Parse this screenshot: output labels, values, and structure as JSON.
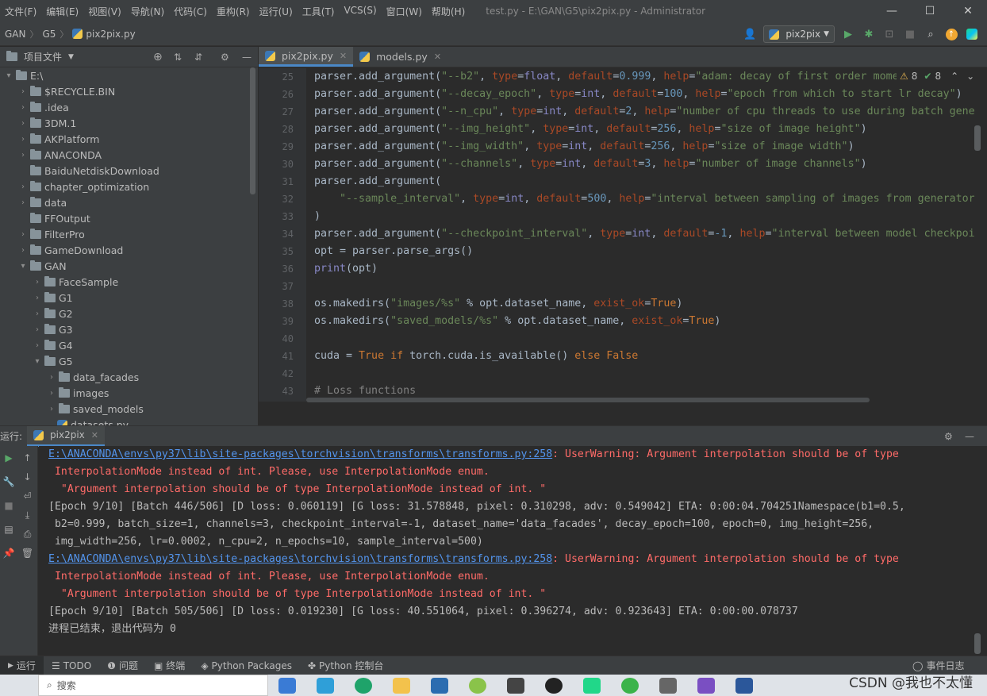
{
  "menu": {
    "items": [
      "文件(F)",
      "编辑(E)",
      "视图(V)",
      "导航(N)",
      "代码(C)",
      "重构(R)",
      "运行(U)",
      "工具(T)",
      "VCS(S)",
      "窗口(W)",
      "帮助(H)"
    ],
    "window_title": "test.py - E:\\GAN\\G5\\pix2pix.py - Administrator"
  },
  "breadcrumbs": [
    "GAN",
    "G5",
    "pix2pix.py"
  ],
  "run_config": "pix2pix",
  "project": {
    "header": "项目文件",
    "tree": [
      {
        "label": "E:\\",
        "indent": 0,
        "arrow": "open",
        "folder": true
      },
      {
        "label": "$RECYCLE.BIN",
        "indent": 1,
        "arrow": "closed",
        "folder": true
      },
      {
        "label": ".idea",
        "indent": 1,
        "arrow": "closed",
        "folder": true
      },
      {
        "label": "3DM.1",
        "indent": 1,
        "arrow": "closed",
        "folder": true
      },
      {
        "label": "AKPlatform",
        "indent": 1,
        "arrow": "closed",
        "folder": true
      },
      {
        "label": "ANACONDA",
        "indent": 1,
        "arrow": "closed",
        "folder": true
      },
      {
        "label": "BaiduNetdiskDownload",
        "indent": 1,
        "arrow": "none",
        "folder": true
      },
      {
        "label": "chapter_optimization",
        "indent": 1,
        "arrow": "closed",
        "folder": true
      },
      {
        "label": "data",
        "indent": 1,
        "arrow": "closed",
        "folder": true
      },
      {
        "label": "FFOutput",
        "indent": 1,
        "arrow": "none",
        "folder": true
      },
      {
        "label": "FilterPro",
        "indent": 1,
        "arrow": "closed",
        "folder": true
      },
      {
        "label": "GameDownload",
        "indent": 1,
        "arrow": "closed",
        "folder": true
      },
      {
        "label": "GAN",
        "indent": 1,
        "arrow": "open",
        "folder": true
      },
      {
        "label": "FaceSample",
        "indent": 2,
        "arrow": "closed",
        "folder": true
      },
      {
        "label": "G1",
        "indent": 2,
        "arrow": "closed",
        "folder": true
      },
      {
        "label": "G2",
        "indent": 2,
        "arrow": "closed",
        "folder": true
      },
      {
        "label": "G3",
        "indent": 2,
        "arrow": "closed",
        "folder": true
      },
      {
        "label": "G4",
        "indent": 2,
        "arrow": "closed",
        "folder": true
      },
      {
        "label": "G5",
        "indent": 2,
        "arrow": "open",
        "folder": true
      },
      {
        "label": "data_facades",
        "indent": 3,
        "arrow": "closed",
        "folder": true
      },
      {
        "label": "images",
        "indent": 3,
        "arrow": "closed",
        "folder": true
      },
      {
        "label": "saved_models",
        "indent": 3,
        "arrow": "closed",
        "folder": true
      },
      {
        "label": "datasets.py",
        "indent": 3,
        "arrow": "none",
        "folder": false
      }
    ]
  },
  "editor": {
    "tabs": [
      {
        "label": "pix2pix.py",
        "active": true
      },
      {
        "label": "models.py",
        "active": false
      }
    ],
    "inspection": {
      "warnings": "8",
      "ok": "8"
    },
    "lines": [
      {
        "n": "25",
        "html": "parser.add_argument(<span class=\"s\">\"--b2\"</span>, <span class=\"prm\">type</span>=<span class=\"bi\">float</span>, <span class=\"prm\">default</span>=<span class=\"num\">0.999</span>, <span class=\"prm\">help</span>=<span class=\"s\">\"adam: decay of first order momentum of gradient\"</span>)"
      },
      {
        "n": "26",
        "html": "parser.add_argument(<span class=\"s\">\"--decay_epoch\"</span>, <span class=\"prm\">type</span>=<span class=\"bi\">int</span>, <span class=\"prm\">default</span>=<span class=\"num\">100</span>, <span class=\"prm\">help</span>=<span class=\"s\">\"epoch from which to start lr decay\"</span>)"
      },
      {
        "n": "27",
        "html": "parser.add_argument(<span class=\"s\">\"--n_cpu\"</span>, <span class=\"prm\">type</span>=<span class=\"bi\">int</span>, <span class=\"prm\">default</span>=<span class=\"num\">2</span>, <span class=\"prm\">help</span>=<span class=\"s\">\"number of cpu threads to use during batch generation\"</span>)"
      },
      {
        "n": "28",
        "html": "parser.add_argument(<span class=\"s\">\"--img_height\"</span>, <span class=\"prm\">type</span>=<span class=\"bi\">int</span>, <span class=\"prm\">default</span>=<span class=\"num\">256</span>, <span class=\"prm\">help</span>=<span class=\"s\">\"size of image height\"</span>)"
      },
      {
        "n": "29",
        "html": "parser.add_argument(<span class=\"s\">\"--img_width\"</span>, <span class=\"prm\">type</span>=<span class=\"bi\">int</span>, <span class=\"prm\">default</span>=<span class=\"num\">256</span>, <span class=\"prm\">help</span>=<span class=\"s\">\"size of image width\"</span>)"
      },
      {
        "n": "30",
        "html": "parser.add_argument(<span class=\"s\">\"--channels\"</span>, <span class=\"prm\">type</span>=<span class=\"bi\">int</span>, <span class=\"prm\">default</span>=<span class=\"num\">3</span>, <span class=\"prm\">help</span>=<span class=\"s\">\"number of image channels\"</span>)"
      },
      {
        "n": "31",
        "html": "parser.add_argument("
      },
      {
        "n": "32",
        "html": "    <span class=\"s\">\"--sample_interval\"</span>, <span class=\"prm\">type</span>=<span class=\"bi\">int</span>, <span class=\"prm\">default</span>=<span class=\"num\">500</span>, <span class=\"prm\">help</span>=<span class=\"s\">\"interval between sampling of images from generators\"</span>"
      },
      {
        "n": "33",
        "html": ")"
      },
      {
        "n": "34",
        "html": "parser.add_argument(<span class=\"s\">\"--checkpoint_interval\"</span>, <span class=\"prm\">type</span>=<span class=\"bi\">int</span>, <span class=\"prm\">default</span>=<span class=\"num\">-1</span>, <span class=\"prm\">help</span>=<span class=\"s\">\"interval between model checkpoints\"</span>)"
      },
      {
        "n": "35",
        "html": "opt = parser.parse_args()"
      },
      {
        "n": "36",
        "html": "<span class=\"bi\">print</span>(opt)"
      },
      {
        "n": "37",
        "html": ""
      },
      {
        "n": "38",
        "html": "os.makedirs(<span class=\"s\">\"images/%s\"</span> % opt.dataset_name, <span class=\"prm\">exist_ok</span>=<span class=\"kw\">True</span>)"
      },
      {
        "n": "39",
        "html": "os.makedirs(<span class=\"s\">\"saved_models/%s\"</span> % opt.dataset_name, <span class=\"prm\">exist_ok</span>=<span class=\"kw\">True</span>)"
      },
      {
        "n": "40",
        "html": ""
      },
      {
        "n": "41",
        "html": "cuda = <span class=\"kw\">True if</span> torch.cuda.is_available() <span class=\"kw\">else False</span>"
      },
      {
        "n": "42",
        "html": ""
      },
      {
        "n": "43",
        "html": "<span class=\"cm\"># Loss functions</span>"
      }
    ]
  },
  "run": {
    "label": "运行:",
    "tab": "pix2pix",
    "console": [
      {
        "html": "<span class=\"link\">E:\\ANACONDA\\envs\\py37\\lib\\site-packages\\torchvision\\transforms\\transforms.py:258</span><span class=\"err\">: UserWarning: Argument interpolation should be of type</span>"
      },
      {
        "html": "<span class=\"err\"> InterpolationMode instead of int. Please, use InterpolationMode enum.</span>"
      },
      {
        "html": "<span class=\"err\">  \"Argument interpolation should be of type InterpolationMode instead of int. \"</span>"
      },
      {
        "html": "[Epoch 9/10] [Batch 446/506] [D loss: 0.060119] [G loss: 31.578848, pixel: 0.310298, adv: 0.549042] ETA: 0:00:04.704251Namespace(b1=0.5,"
      },
      {
        "html": " b2=0.999, batch_size=1, channels=3, checkpoint_interval=-1, dataset_name='data_facades', decay_epoch=100, epoch=0, img_height=256,"
      },
      {
        "html": " img_width=256, lr=0.0002, n_cpu=2, n_epochs=10, sample_interval=500)"
      },
      {
        "html": "<span class=\"link\">E:\\ANACONDA\\envs\\py37\\lib\\site-packages\\torchvision\\transforms\\transforms.py:258</span><span class=\"err\">: UserWarning: Argument interpolation should be of type</span>"
      },
      {
        "html": "<span class=\"err\"> InterpolationMode instead of int. Please, use InterpolationMode enum.</span>"
      },
      {
        "html": "<span class=\"err\">  \"Argument interpolation should be of type InterpolationMode instead of int. \"</span>"
      },
      {
        "html": "[Epoch 9/10] [Batch 505/506] [D loss: 0.019230] [G loss: 40.551064, pixel: 0.396274, adv: 0.923643] ETA: 0:00:00.078737"
      },
      {
        "html": "进程已结束，退出代码为 0"
      }
    ]
  },
  "bottom_tools": [
    "运行",
    "TODO",
    "问题",
    "终端",
    "Python Packages",
    "Python 控制台"
  ],
  "event_log": "事件日志",
  "taskbar": {
    "search_placeholder": "搜索"
  },
  "watermark": "CSDN @我也不太懂"
}
